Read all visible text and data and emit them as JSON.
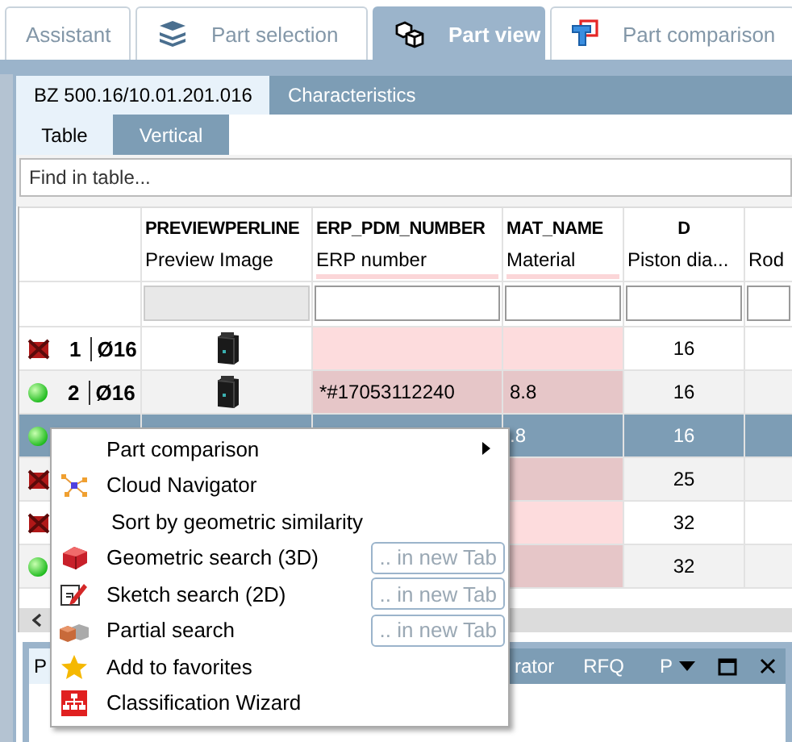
{
  "tabs": [
    {
      "label": "Assistant",
      "kind": "plain",
      "selected": false
    },
    {
      "label": "Part selection",
      "kind": "selection",
      "selected": false
    },
    {
      "label": "Part view",
      "kind": "view",
      "selected": true
    },
    {
      "label": "Part comparison",
      "kind": "comparison",
      "selected": false
    }
  ],
  "part_tabs": [
    {
      "label": "BZ 500.16/10.01.201.016",
      "selected": true
    },
    {
      "label": "Characteristics",
      "selected": false
    }
  ],
  "view_tabs": [
    {
      "label": "Table",
      "selected": true
    },
    {
      "label": "Vertical",
      "selected": false
    }
  ],
  "search": {
    "placeholder": "Find in table..."
  },
  "table": {
    "columns": [
      {
        "name": "PREVIEWPERLINE",
        "label": "Preview Image",
        "required": false,
        "kind": "image"
      },
      {
        "name": "ERP_PDM_NUMBER",
        "label": "ERP number",
        "required": true,
        "kind": "text"
      },
      {
        "name": "MAT_NAME",
        "label": "Material",
        "required": true,
        "kind": "text"
      },
      {
        "name": "D",
        "label": "Piston dia...",
        "required": false,
        "kind": "number"
      },
      {
        "label": "Rod",
        "required": false,
        "kind": "text"
      }
    ],
    "rows": [
      {
        "valid": false,
        "number": "1",
        "size": "Ø16",
        "preview": true,
        "selected": false,
        "cells": [
          null,
          null,
          null,
          "16",
          null
        ]
      },
      {
        "valid": true,
        "number": "2",
        "size": "Ø16",
        "preview": true,
        "selected": false,
        "cells": [
          null,
          "*#17053112240",
          "8.8",
          "16",
          null
        ]
      },
      {
        "valid": true,
        "selected": true,
        "cells": [
          null,
          null,
          ".8",
          "16",
          null
        ]
      },
      {
        "valid": false,
        "selected": false,
        "cells": [
          null,
          null,
          null,
          "25",
          null
        ]
      },
      {
        "valid": false,
        "selected": false,
        "cells": [
          null,
          null,
          null,
          "32",
          null
        ]
      },
      {
        "valid": true,
        "selected": false,
        "cells": [
          null,
          null,
          null,
          "32",
          null
        ]
      }
    ]
  },
  "context_menu": [
    {
      "label": "Part comparison",
      "kind": "submenu"
    },
    {
      "label": "Cloud Navigator",
      "kind": "navigator"
    },
    {
      "label": "Sort by geometric similarity",
      "kind": "plain"
    },
    {
      "label": "Geometric search (3D)",
      "kind": "geometric",
      "button": ".. in new Tab"
    },
    {
      "label": "Sketch search (2D)",
      "kind": "sketch",
      "button": ".. in new Tab"
    },
    {
      "label": "Partial search",
      "kind": "partial",
      "button": ".. in new Tab"
    },
    {
      "label": "Add to favorites",
      "kind": "favorite"
    },
    {
      "label": "Classification Wizard",
      "kind": "wizard"
    }
  ],
  "bottom_panel": {
    "tabs": [
      {
        "label": "P",
        "selected": true
      },
      {
        "label": "rator",
        "selected": false
      },
      {
        "label": "RFQ",
        "selected": false
      },
      {
        "label": "P",
        "selected": false
      }
    ]
  }
}
